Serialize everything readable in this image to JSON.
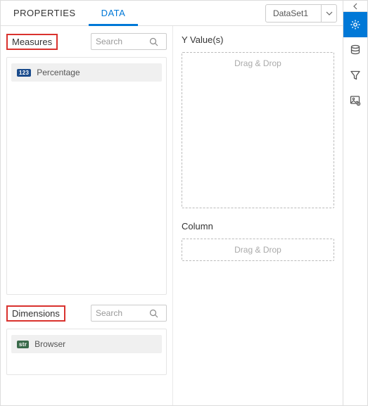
{
  "tabs": {
    "properties": "PROPERTIES",
    "data": "DATA"
  },
  "dataset": {
    "value": "DataSet1"
  },
  "measures": {
    "title": "Measures",
    "search_placeholder": "Search",
    "items": [
      {
        "badge": "123",
        "label": "Percentage"
      }
    ]
  },
  "dimensions": {
    "title": "Dimensions",
    "search_placeholder": "Search",
    "items": [
      {
        "badge": "str",
        "label": "Browser"
      }
    ]
  },
  "yvalues": {
    "title": "Y Value(s)",
    "placeholder": "Drag & Drop"
  },
  "column": {
    "title": "Column",
    "placeholder": "Drag & Drop"
  }
}
